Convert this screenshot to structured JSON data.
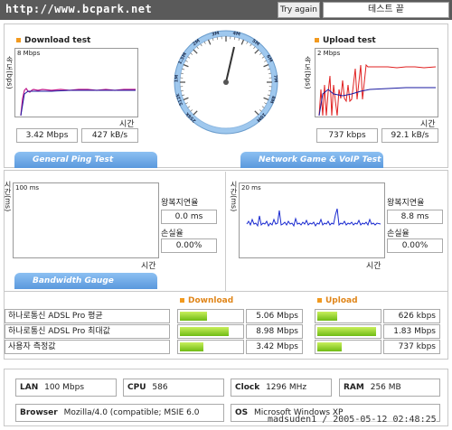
{
  "header": {
    "url": "http://www.bcpark.net",
    "try_again": "Try again",
    "status": "테스트 끝"
  },
  "download": {
    "title": "Download test",
    "ylabel": "속도(bps)",
    "scale": "8 Mbps",
    "xlabel": "시간",
    "mbps": "3.42 Mbps",
    "kBs": "427 kB/s"
  },
  "upload": {
    "title": "Upload test",
    "ylabel": "속도(bps)",
    "scale": "2 Mbps",
    "xlabel": "시간",
    "kbps": "737 kbps",
    "kBs": "92.1 kB/s"
  },
  "gauge": {
    "ticks": [
      "256k",
      "512k",
      "1M",
      "1.5M",
      "2M",
      "3M",
      "4M",
      "5M",
      "6M",
      "7M",
      "8M",
      "10M"
    ]
  },
  "ping": {
    "banner": "General Ping Test",
    "ylabel": "시간(ms)",
    "scale": "100 ms",
    "xlabel": "시간",
    "rtt_label": "왕복지연율",
    "rtt": "0.0 ms",
    "loss_label": "손실율",
    "loss": "0.00%"
  },
  "game": {
    "banner": "Network Game & VoIP Test",
    "ylabel": "시간(ms)",
    "scale": "20 ms",
    "xlabel": "시간",
    "rtt_label": "왕복지연율",
    "rtt": "8.8 ms",
    "loss_label": "손실율",
    "loss": "0.00%"
  },
  "bandwidth": {
    "banner": "Bandwidth Gauge",
    "download_label": "Download",
    "upload_label": "Upload",
    "rows": [
      {
        "label": "하나로통신 ADSL Pro 평균",
        "down": "5.06 Mbps",
        "down_frac": 0.44,
        "up": "626 kbps",
        "up_frac": 0.33
      },
      {
        "label": "하나로통신 ADSL Pro 최대값",
        "down": "8.98 Mbps",
        "down_frac": 0.8,
        "up": "1.83 Mbps",
        "up_frac": 0.95
      },
      {
        "label": "사용자 측정값",
        "down": "3.42 Mbps",
        "down_frac": 0.38,
        "up": "737 kbps",
        "up_frac": 0.4
      }
    ]
  },
  "system": {
    "lan_label": "LAN",
    "lan": "100 Mbps",
    "cpu_label": "CPU",
    "cpu": "586",
    "clock_label": "Clock",
    "clock": "1296 MHz",
    "ram_label": "RAM",
    "ram": "256 MB",
    "browser_label": "Browser",
    "browser": "Mozilla/4.0 (compatible; MSIE 6.0",
    "os_label": "OS",
    "os": "Microsoft Windows XP"
  },
  "footer": "madsuden1 / 2005-05-12 02:48:25",
  "colors": {
    "accent": "#f29a1f",
    "download_line": "#c0188c",
    "upload_line": "#e02020",
    "avg_line": "#1a1aa0",
    "bar": "#7cc41a"
  }
}
